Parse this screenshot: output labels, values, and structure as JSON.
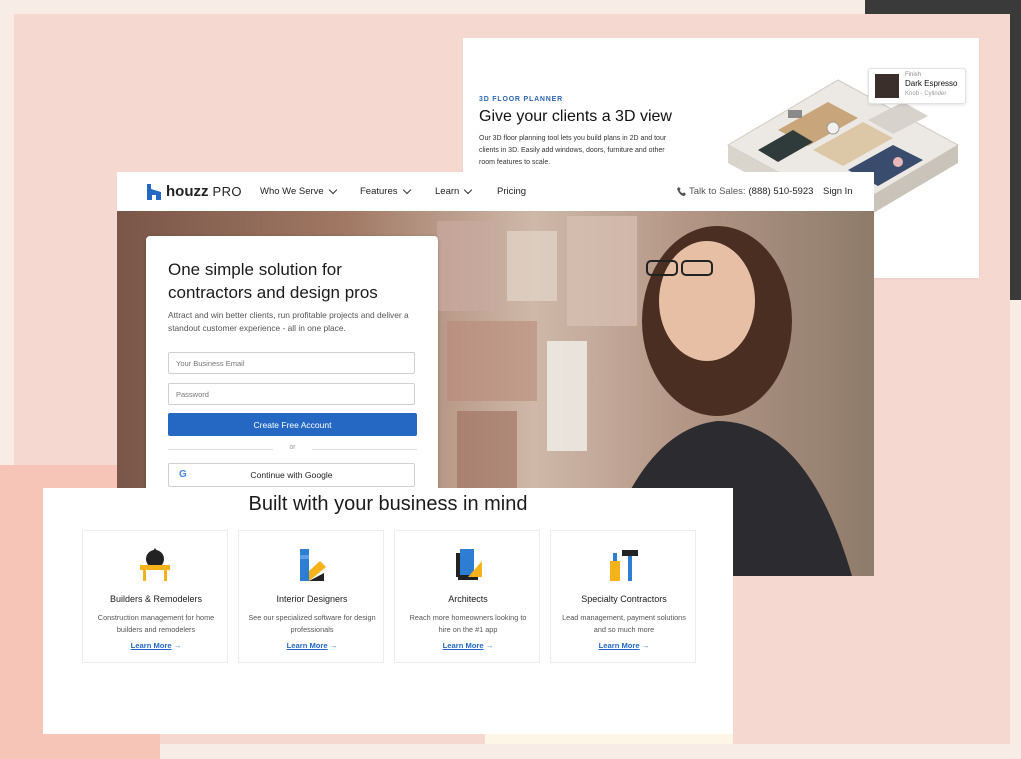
{
  "planner": {
    "eyebrow": "3D FLOOR PLANNER",
    "title": "Give your clients a 3D view",
    "description": "Our 3D floor planning tool lets you build plans in 2D and tour clients in 3D. Easily add windows, doors, furniture and other room features to scale.",
    "finish_label": "Finish",
    "finish_value": "Dark Espresso",
    "finish_sub": "Knob - Cylinder"
  },
  "nav": {
    "brand": "houzz",
    "pro": "PRO",
    "items": [
      {
        "label": "Who We Serve"
      },
      {
        "label": "Features"
      },
      {
        "label": "Learn"
      },
      {
        "label": "Pricing"
      }
    ],
    "talk_to_sales": "Talk to Sales:",
    "phone": "(888) 510-5923",
    "sign_in": "Sign In"
  },
  "signup": {
    "title": "One simple solution for contractors and design pros",
    "subtitle": "Attract and win better clients, run profitable projects and deliver a standout customer experience - all in one place.",
    "email_placeholder": "Your Business Email",
    "password_placeholder": "Password",
    "create_button": "Create Free Account",
    "or": "or",
    "google_button": "Continue with Google"
  },
  "business": {
    "title": "Built with your business in mind",
    "tiles": [
      {
        "icon": "saw-icon",
        "name": "Builders & Remodelers",
        "desc": "Construction management for home builders and remodelers",
        "link": "Learn More"
      },
      {
        "icon": "swatch-icon",
        "name": "Interior Designers",
        "desc": "See our specialized software for design professionals",
        "link": "Learn More"
      },
      {
        "icon": "blueprint-icon",
        "name": "Architects",
        "desc": "Reach more homeowners looking to hire on the #1 app",
        "link": "Learn More"
      },
      {
        "icon": "tools-icon",
        "name": "Specialty Contractors",
        "desc": "Lead management, payment solutions and so much more",
        "link": "Learn More"
      }
    ]
  },
  "colors": {
    "accent": "#2468c4",
    "background": "#f5d9d1"
  }
}
